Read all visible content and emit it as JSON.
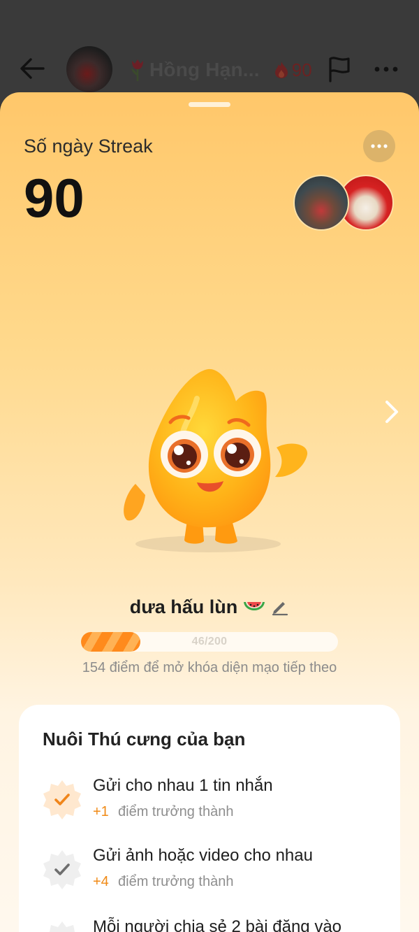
{
  "header": {
    "contact_name": "Hồng Hạn...",
    "streak_count": "90"
  },
  "sheet": {
    "streak_label": "Số ngày Streak",
    "streak_value": "90"
  },
  "pet": {
    "name": "dưa hấu lùn",
    "progress_text": "46/200",
    "progress_fraction": 0.23,
    "hint": "154 điểm để mở khóa diện mạo tiếp theo"
  },
  "card": {
    "title": "Nuôi Thú cưng của bạn",
    "tasks": [
      {
        "title": "Gửi cho nhau 1 tin nhắn",
        "points": "+1",
        "points_label": "điểm trưởng thành",
        "status": "done-today"
      },
      {
        "title": "Gửi ảnh hoặc video cho nhau",
        "points": "+4",
        "points_label": "điểm trưởng thành",
        "status": "done"
      },
      {
        "title": "Mỗi người chia sẻ 2 bài đăng vào",
        "points": "",
        "points_label": "",
        "status": "pending"
      }
    ]
  },
  "colors": {
    "accent": "#ff8a1c",
    "points": "#f08a16",
    "sheet_top": "#ffc76a",
    "sheet_bottom": "#fff8ee"
  },
  "icons": [
    "back-arrow-icon",
    "tulip-icon",
    "fire-icon",
    "flag-icon",
    "more-icon",
    "chevron-right-icon",
    "watermelon-icon",
    "pencil-icon",
    "check-badge-icon"
  ]
}
